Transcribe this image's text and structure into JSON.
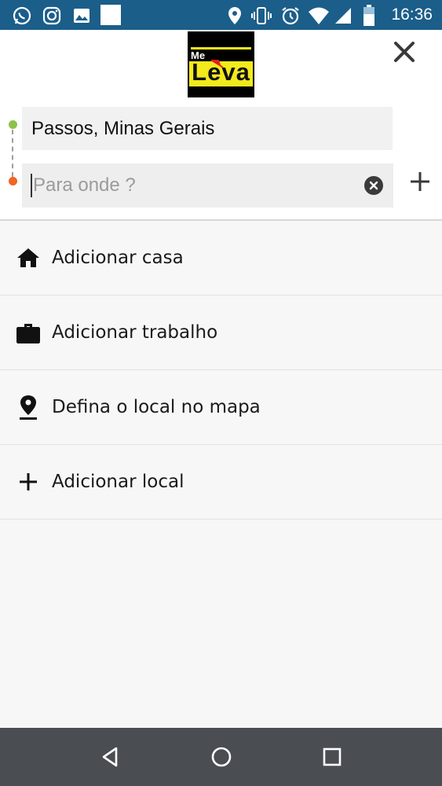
{
  "status_bar": {
    "time": "16:36",
    "left_icons": [
      "whatsapp-icon",
      "instagram-icon",
      "gallery-icon",
      "notification-square-icon"
    ],
    "right_icons": [
      "location-icon",
      "vibrate-icon",
      "alarm-icon",
      "wifi-icon",
      "signal-icon",
      "battery-icon"
    ]
  },
  "header": {
    "logo_text_top": "Me",
    "logo_text_main": "Leva",
    "close_icon": "close-icon"
  },
  "route": {
    "origin_value": "Passos, Minas Gerais",
    "destination_placeholder": "Para onde ?",
    "destination_value": ""
  },
  "list": {
    "items": [
      {
        "icon": "home-icon",
        "label": "Adicionar casa"
      },
      {
        "icon": "briefcase-icon",
        "label": "Adicionar trabalho"
      },
      {
        "icon": "map-pin-icon",
        "label": "Defina o local no mapa"
      },
      {
        "icon": "plus-icon",
        "label": "Adicionar local"
      }
    ]
  },
  "nav_bar": {
    "buttons": [
      "back-icon",
      "home-circle-icon",
      "recents-icon"
    ]
  },
  "colors": {
    "status_bar": "#1b5e8a",
    "origin_dot": "#8bc34a",
    "destination_dot": "#f26522",
    "logo_yellow": "#f2ea1c",
    "nav_bar": "#4a4d52"
  }
}
